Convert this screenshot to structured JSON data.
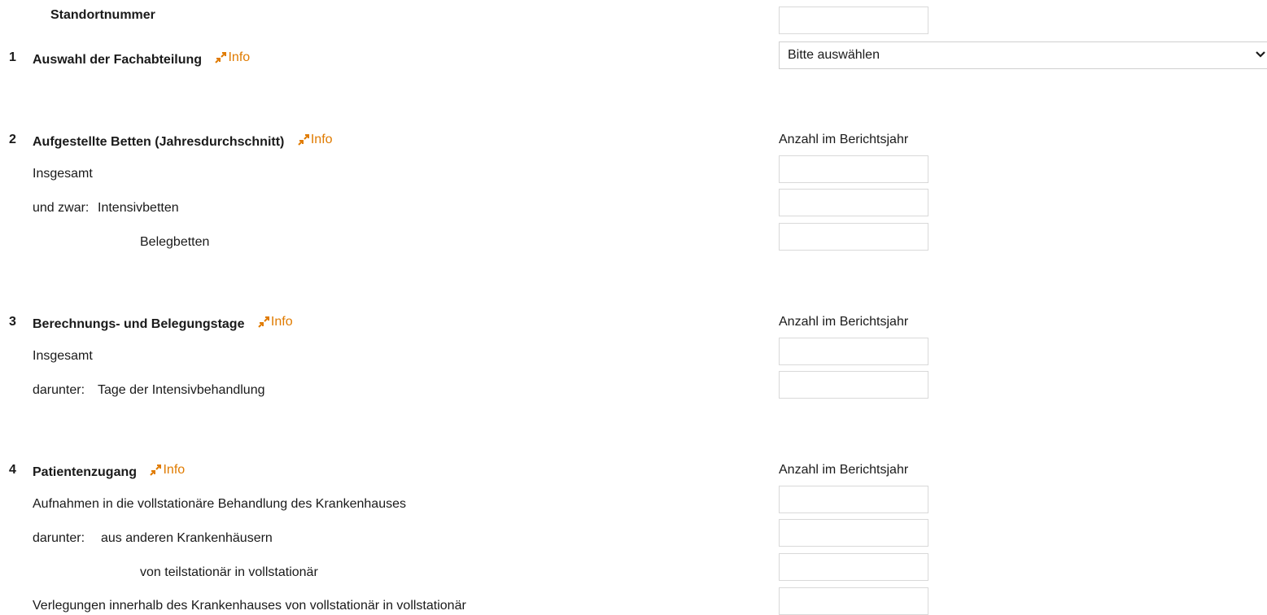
{
  "standort": {
    "label": "Standortnummer",
    "value": ""
  },
  "info_label": "Info",
  "section1": {
    "number": "1",
    "title": "Auswahl der Fachabteilung",
    "select": {
      "selected": "Bitte auswählen",
      "icon": "chevron-down-icon"
    }
  },
  "section2": {
    "number": "2",
    "title": "Aufgestellte Betten (Jahresdurchschnitt)",
    "column_header": "Anzahl im Berichtsjahr",
    "rows": [
      {
        "prefix": "",
        "label": "Insgesamt",
        "value": ""
      },
      {
        "prefix": "und zwar:",
        "label": "Intensivbetten",
        "value": ""
      },
      {
        "prefix": "",
        "label": "Belegbetten",
        "value": ""
      }
    ]
  },
  "section3": {
    "number": "3",
    "title": "Berechnungs- und Belegungstage",
    "column_header": "Anzahl im Berichtsjahr",
    "rows": [
      {
        "prefix": "",
        "label": "Insgesamt",
        "value": ""
      },
      {
        "prefix": "darunter:",
        "label": "Tage der Intensivbehandlung",
        "value": ""
      }
    ]
  },
  "section4": {
    "number": "4",
    "title": "Patientenzugang",
    "column_header": "Anzahl im Berichtsjahr",
    "rows": [
      {
        "prefix": "",
        "label": "Aufnahmen in die vollstationäre Behandlung des Krankenhauses",
        "value": ""
      },
      {
        "prefix": "darunter:",
        "label": "aus anderen Krankenhäusern",
        "value": ""
      },
      {
        "prefix": "",
        "label": "von teilstationär in vollstationär",
        "value": ""
      },
      {
        "prefix": "",
        "label": "Verlegungen innerhalb des Krankenhauses von vollstationär in vollstationär",
        "value": ""
      }
    ]
  },
  "colors": {
    "info_link": "#e07b00",
    "field_border": "#d9d9d9",
    "text": "#1a1a1a"
  }
}
